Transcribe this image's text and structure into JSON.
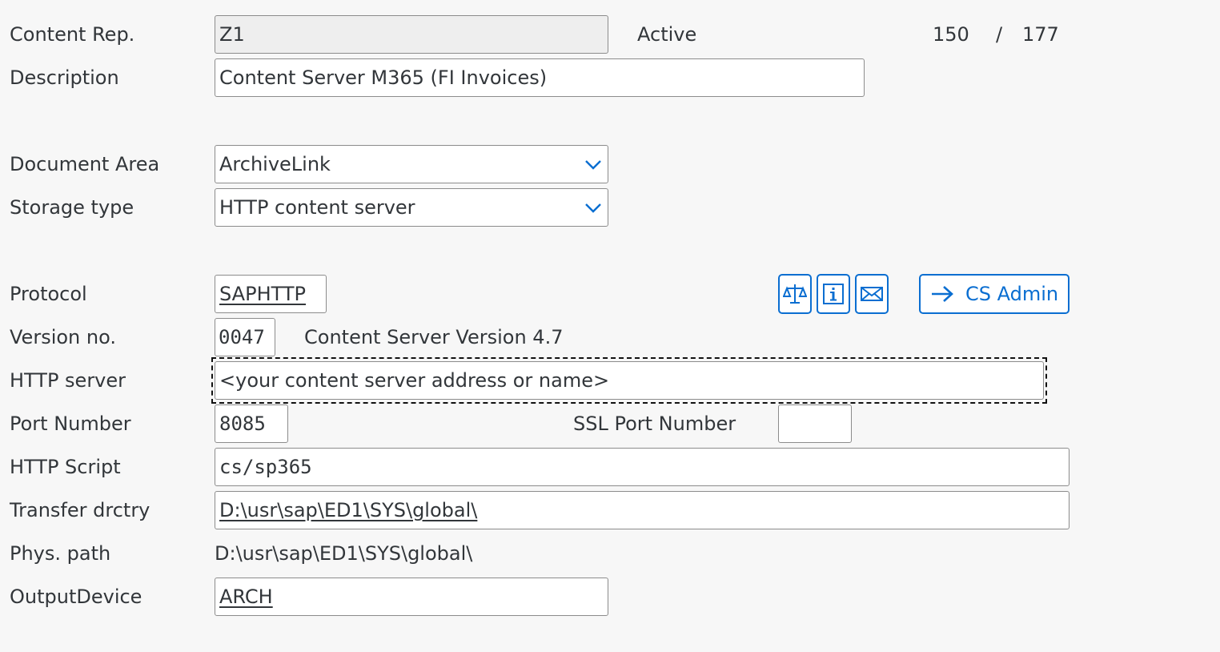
{
  "header": {
    "content_rep_label": "Content Rep.",
    "content_rep_value": "Z1",
    "status": "Active",
    "page_current": "150",
    "page_separator": "/",
    "page_total": "177",
    "description_label": "Description",
    "description_value": "Content Server M365 (FI Invoices)"
  },
  "document_area": {
    "label": "Document Area",
    "value": "ArchiveLink"
  },
  "storage_type": {
    "label": "Storage type",
    "value": "HTTP content server"
  },
  "protocol": {
    "label": "Protocol",
    "value": "SAPHTTP"
  },
  "toolbar": {
    "icons": [
      "balance-scale-icon",
      "info-icon",
      "envelope-icon"
    ],
    "cs_admin_label": "CS Admin",
    "cs_admin_icon": "arrow-right-icon",
    "accent_color": "#0a6ed1"
  },
  "version": {
    "label": "Version no.",
    "value": "0047",
    "text": "Content Server Version 4.7"
  },
  "http_server": {
    "label": "HTTP server",
    "value": "<your content server address or name>"
  },
  "port": {
    "label": "Port Number",
    "value": "8085",
    "ssl_label": "SSL Port Number",
    "ssl_value": ""
  },
  "http_script": {
    "label": "HTTP Script",
    "value": "cs/sp365"
  },
  "transfer_dir": {
    "label": "Transfer drctry",
    "value": "D:\\usr\\sap\\ED1\\SYS\\global\\"
  },
  "phys_path": {
    "label": "Phys. path",
    "value": "D:\\usr\\sap\\ED1\\SYS\\global\\"
  },
  "output_device": {
    "label": "OutputDevice",
    "value": "ARCH"
  }
}
